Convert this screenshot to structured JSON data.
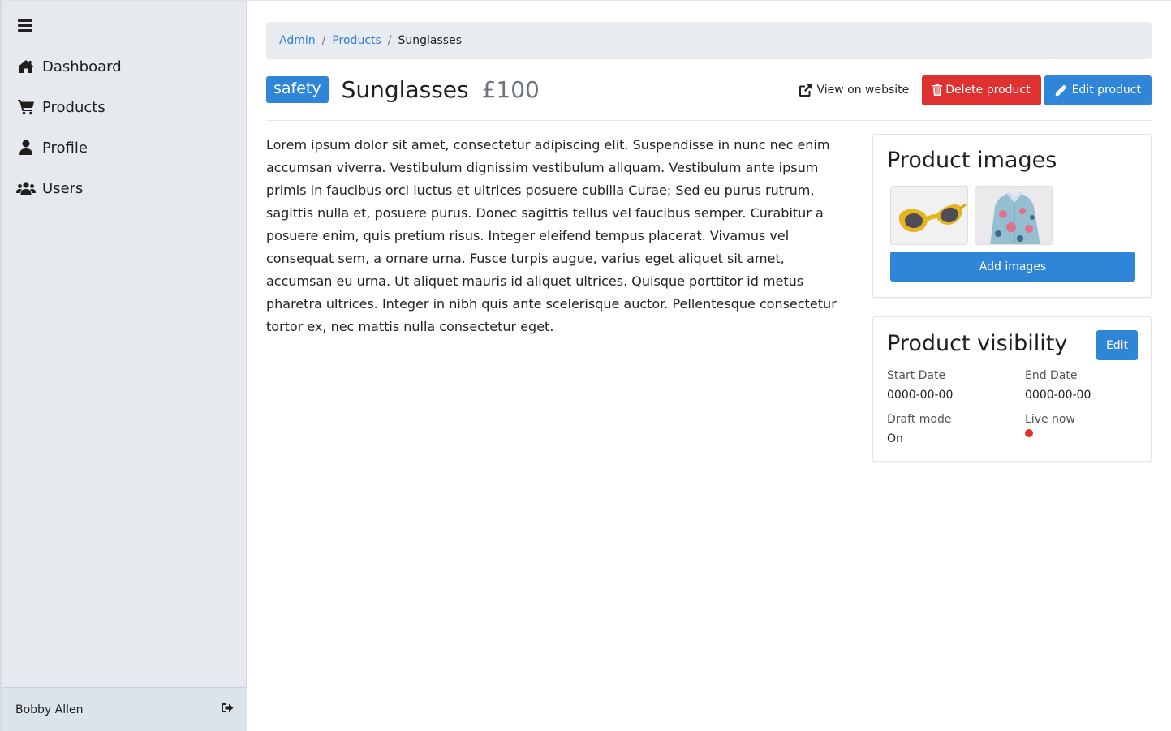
{
  "sidebar": {
    "items": [
      {
        "label": "Dashboard",
        "icon": "home-icon"
      },
      {
        "label": "Products",
        "icon": "cart-icon"
      },
      {
        "label": "Profile",
        "icon": "user-icon"
      },
      {
        "label": "Users",
        "icon": "users-icon"
      }
    ],
    "footer": {
      "user_name": "Bobby Allen",
      "logout_icon": "logout-icon"
    }
  },
  "breadcrumb": {
    "items": [
      "Admin",
      "Products"
    ],
    "separator": "/",
    "current": "Sunglasses"
  },
  "product": {
    "tag": "safety",
    "title": "Sunglasses",
    "price": "£100",
    "description": "Lorem ipsum dolor sit amet, consectetur adipiscing elit. Suspendisse in nunc nec enim accumsan viverra. Vestibulum dignissim vestibulum aliquam. Vestibulum ante ipsum primis in faucibus orci luctus et ultrices posuere cubilia Curae; Sed eu purus rutrum, sagittis nulla et, posuere purus. Donec sagittis tellus vel faucibus semper. Curabitur a posuere enim, quis pretium risus. Integer eleifend tempus placerat. Vivamus vel consequat sem, a ornare urna. Fusce turpis augue, varius eget aliquet sit amet, accumsan eu urna. Ut aliquet mauris id aliquet ultrices. Quisque porttitor id metus pharetra ultrices. Integer in nibh quis ante scelerisque auctor. Pellentesque consectetur tortor ex, nec mattis nulla consectetur eget."
  },
  "actions": {
    "view_label": "View on website",
    "delete_label": "Delete product",
    "edit_label": "Edit product"
  },
  "images_card": {
    "title": "Product images",
    "add_label": "Add images"
  },
  "visibility_card": {
    "title": "Product visibility",
    "edit_label": "Edit",
    "start_date_label": "Start Date",
    "start_date": "0000-00-00",
    "end_date_label": "End Date",
    "end_date": "0000-00-00",
    "draft_label": "Draft mode",
    "draft_value": "On",
    "live_label": "Live now",
    "live_status_color": "#e03131"
  },
  "colors": {
    "accent": "#2f86d9",
    "danger": "#e03131",
    "sidebar_bg": "#e6e9ee"
  }
}
